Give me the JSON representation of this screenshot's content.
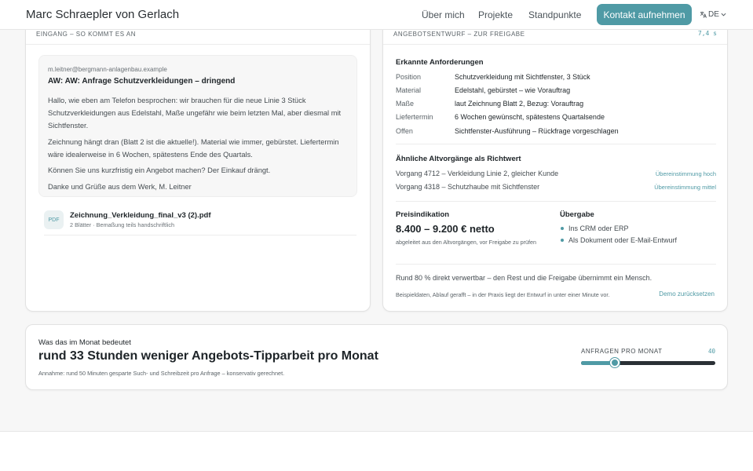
{
  "header": {
    "brand": "Marc Schraepler von Gerlach",
    "nav": [
      "Über mich",
      "Projekte",
      "Standpunkte"
    ],
    "cta": "Kontakt aufnehmen",
    "lang": "DE",
    "icons": {
      "lang": "translate-icon",
      "chevron": "chevron-down-icon"
    }
  },
  "inbox": {
    "title": "EINGANG – SO KOMMT ES AN",
    "email": {
      "from": "m.leitner@bergmann-anlagenbau.example",
      "subject": "AW: AW: Anfrage Schutzverkleidungen – dringend",
      "paragraphs": [
        "Hallo, wie eben am Telefon besprochen: wir brauchen für die neue Linie 3 Stück Schutzverkleidungen aus Edelstahl, Maße ungefähr wie beim letzten Mal, aber diesmal mit Sichtfenster.",
        "Zeichnung hängt dran (Blatt 2 ist die aktuelle!). Material wie immer, gebürstet. Liefertermin wäre idealerweise in 6 Wochen, spätestens Ende des Quartals.",
        "Können Sie uns kurzfristig ein Angebot machen? Der Einkauf drängt.",
        "Danke und Grüße aus dem Werk, M. Leitner"
      ]
    },
    "attachment": {
      "badge": "PDF",
      "name": "Zeichnung_Verkleidung_final_v3 (2).pdf",
      "meta": "2 Blätter · Bemaßung teils handschriftlich"
    }
  },
  "draft": {
    "title": "ANGEBOTSENTWURF – ZUR FREIGABE",
    "timer": "7,4 s",
    "requirements": {
      "title": "Erkannte Anforderungen",
      "rows": [
        {
          "label": "Position",
          "value": "Schutzverkleidung mit Sichtfenster, 3 Stück"
        },
        {
          "label": "Material",
          "value": "Edelstahl, gebürstet – wie Vorauftrag"
        },
        {
          "label": "Maße",
          "value": "laut Zeichnung Blatt 2, Bezug: Vorauftrag"
        },
        {
          "label": "Liefertermin",
          "value": "6 Wochen gewünscht, spätestens Quartalsende"
        },
        {
          "label": "Offen",
          "value": "Sichtfenster-Ausführung – Rückfrage vorgeschlagen"
        }
      ]
    },
    "similar": {
      "title": "Ähnliche Altvorgänge als Richtwert",
      "rows": [
        {
          "text": "Vorgang 4712 – Verkleidung Linie 2, gleicher Kunde",
          "match": "Übereinstimmung hoch"
        },
        {
          "text": "Vorgang 4318 – Schutzhaube mit Sichtfenster",
          "match": "Übereinstimmung mittel"
        }
      ]
    },
    "price": {
      "title": "Preisindikation",
      "value": "8.400 – 9.200 € netto",
      "note": "abgeleitet aus den Altvorgängen, vor Freigabe zu prüfen"
    },
    "handover": {
      "title": "Übergabe",
      "items": [
        "Ins CRM oder ERP",
        "Als Dokument oder E-Mail-Entwurf"
      ]
    },
    "usable": "Rund 80 % direkt verwertbar – den Rest und die Freigabe übernimmt ein Mensch.",
    "footnote": "Beispieldaten, Ablauf gerafft – in der Praxis liegt der Entwurf in unter einer Minute vor.",
    "reset": "Demo zurücksetzen"
  },
  "month": {
    "kicker": "Was das im Monat bedeutet",
    "headline": "rund 33 Stunden weniger Angebots-Tipparbeit pro Monat",
    "note": "Annahme: rund 50 Minuten gesparte Such- und Schreibzeit pro Anfrage – konservativ gerechnet.",
    "slider": {
      "label": "ANFRAGEN PRO MONAT",
      "value": "40",
      "position_fraction": 0.25
    }
  },
  "colors": {
    "accent": "#4f9aa5",
    "text": "#1e2428",
    "muted": "#5b6368"
  }
}
